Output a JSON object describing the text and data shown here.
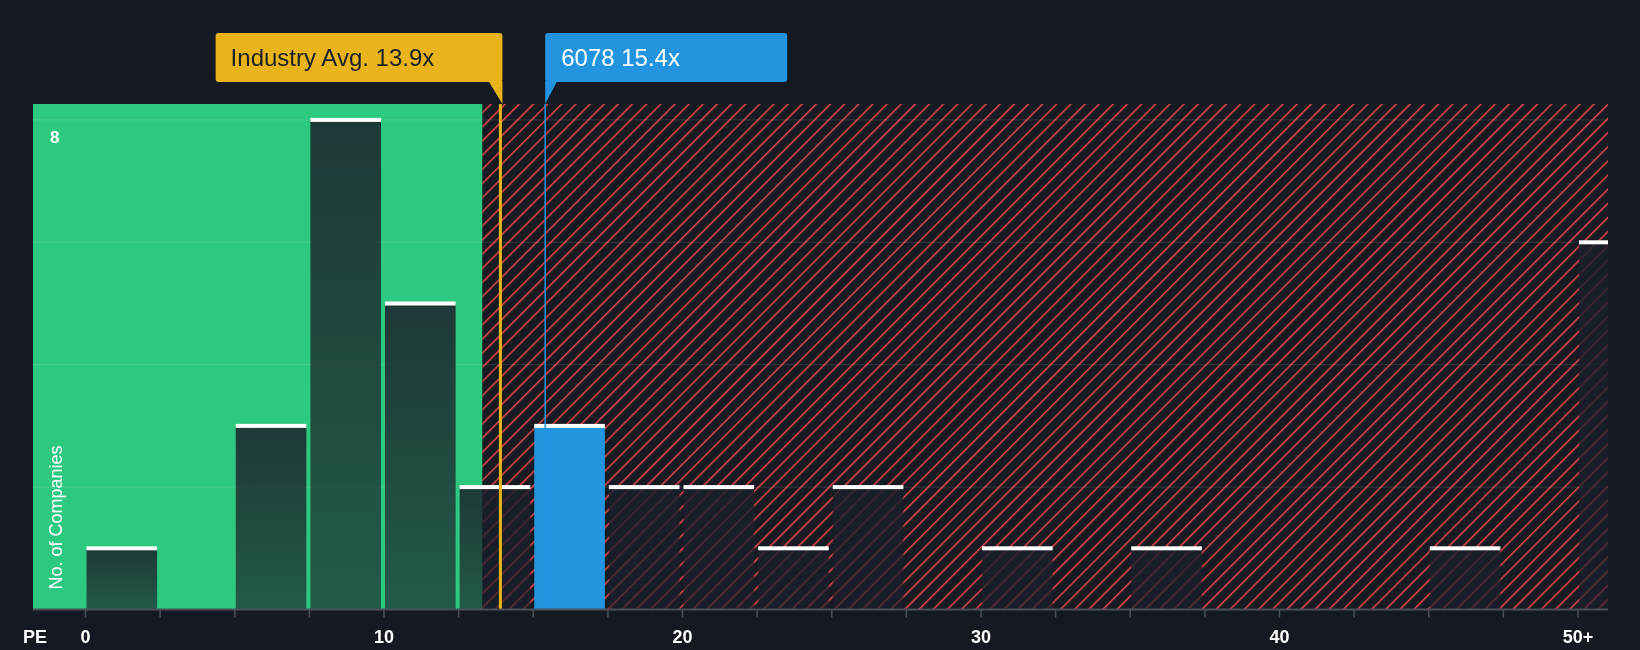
{
  "chart": {
    "x_axis_title": "PE",
    "y_axis_title": "No. of Companies",
    "x_tick_labels": [
      "0",
      "10",
      "20",
      "30",
      "40",
      "50+"
    ],
    "y_tick_label": "8",
    "callouts": [
      {
        "kind": "industry",
        "label": "Industry Avg. 13.9x",
        "color": "#e9b31a"
      },
      {
        "kind": "company",
        "label": "6078 15.4x",
        "color": "#2394e0"
      }
    ]
  }
}
